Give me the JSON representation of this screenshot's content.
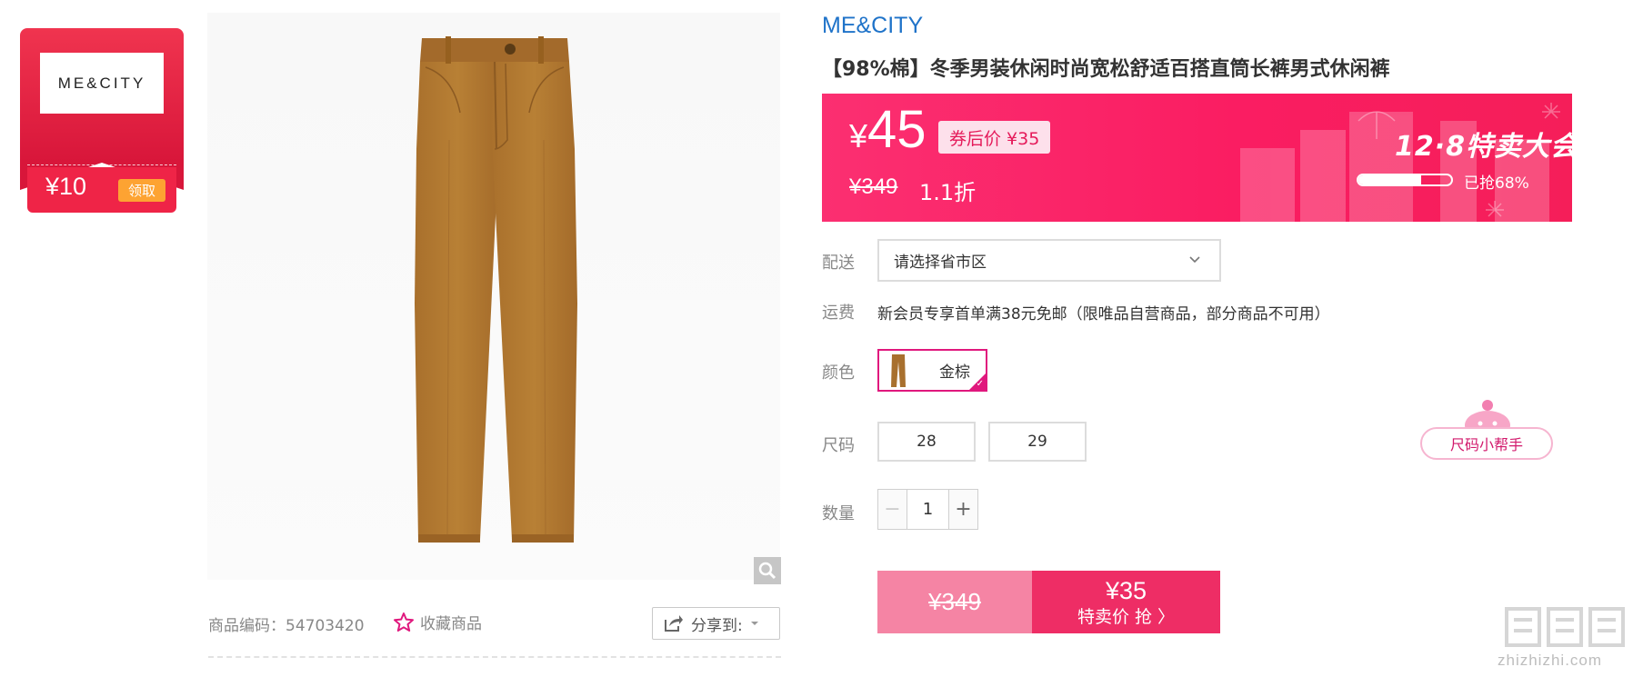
{
  "coupon": {
    "logo_text": "ME&CITY",
    "amount": "¥10",
    "claim_label": "领取"
  },
  "product": {
    "brand": "ME&CITY",
    "title": "【98%棉】冬季男装休闲时尚宽松舒适百搭直筒长裤男式休闲裤",
    "sku_label": "商品编码：54703420",
    "favorite_label": "收藏商品",
    "share_label": "分享到:",
    "image_color": "#b37a33"
  },
  "price": {
    "yen": "¥",
    "value": "45",
    "coupon_price": "券后价 ¥35",
    "original": "¥349",
    "discount": "1.1折",
    "sale_title": "12·8特卖大会",
    "progress_text": "已抢68%",
    "progress_fraction": 0.68
  },
  "delivery": {
    "label": "配送",
    "select_value": "请选择省市区"
  },
  "shipping": {
    "label": "运费",
    "text": "新会员专享首单满38元免邮（限唯品自营商品，部分商品不可用）"
  },
  "color": {
    "label": "颜色",
    "option": "金棕"
  },
  "size": {
    "label": "尺码",
    "options": [
      "28",
      "29"
    ],
    "helper_label": "尺码小帮手"
  },
  "quantity": {
    "label": "数量",
    "value": "1",
    "minus": "−",
    "plus": "+"
  },
  "buy": {
    "original_price": "¥349",
    "sale_price": "¥35",
    "sale_label": "特卖价 抢 〉"
  },
  "watermark": {
    "text": "zhizhizhi.com"
  },
  "colors": {
    "brand_blue": "#1f73c9",
    "banner_pink": "#fb2f71",
    "accent_magenta": "#e0187d",
    "coupon_red": "#d8163a"
  }
}
